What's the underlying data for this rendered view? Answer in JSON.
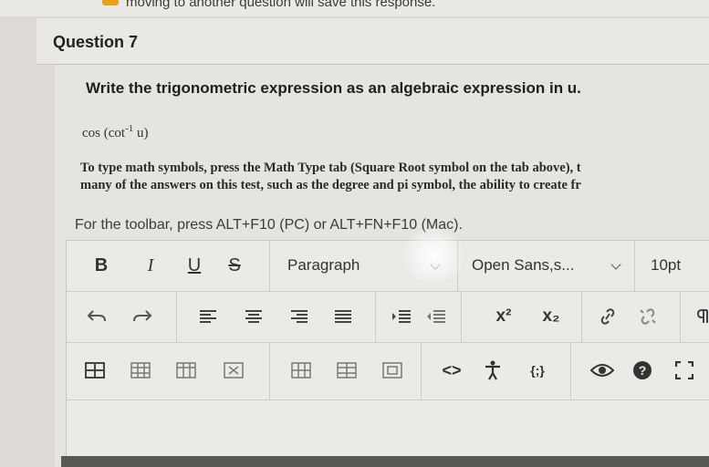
{
  "top_notice": "moving to another question will save this response.",
  "question": {
    "title": "Question 7",
    "prompt": "Write the trigonometric expression as an algebraic expression in u.",
    "math_expr": {
      "prefix": "cos (cot",
      "sup": "-1",
      "suffix": " u)"
    },
    "instructions_line1": "To type math symbols, press the Math Type tab (Square Root symbol on the tab above), t",
    "instructions_line2": "many of the answers on this test, such as the degree and pi symbol, the ability to create fr"
  },
  "toolbar_hint": "For the toolbar, press ALT+F10 (PC) or ALT+FN+F10 (Mac).",
  "editor": {
    "format_buttons": {
      "bold": "B",
      "italic": "I",
      "underline": "U",
      "strike": "S"
    },
    "block_format": "Paragraph",
    "font_family": "Open Sans,s...",
    "font_size": "10pt",
    "superscript": "x²",
    "subscript": "x₂",
    "code_view": "<>",
    "shortcut_braces": "{;}"
  }
}
